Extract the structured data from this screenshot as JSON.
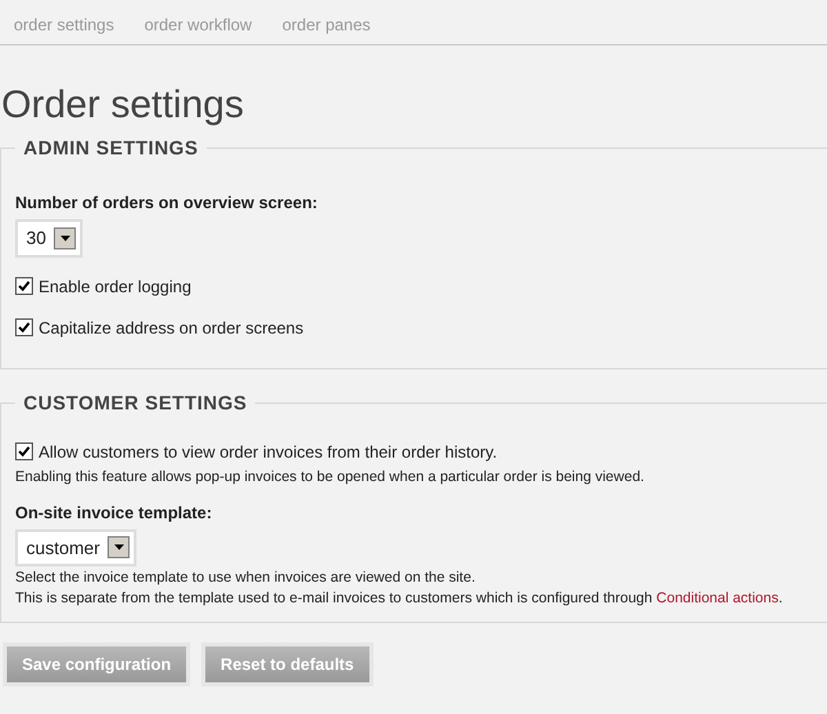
{
  "tabs": [
    {
      "label": "order settings"
    },
    {
      "label": "order workflow"
    },
    {
      "label": "order panes"
    }
  ],
  "title": "Order settings",
  "admin_settings": {
    "legend": "ADMIN SETTINGS",
    "orders_select": {
      "label": "Number of orders on overview screen:",
      "value": "30"
    },
    "checkboxes": [
      {
        "label": "Enable order logging",
        "checked": true
      },
      {
        "label": "Capitalize address on order screens",
        "checked": true
      }
    ]
  },
  "customer_settings": {
    "legend": "CUSTOMER SETTINGS",
    "invoice_checkbox": {
      "label": "Allow customers to view order invoices from their order history.",
      "checked": true,
      "description": "Enabling this feature allows pop-up invoices to be opened when a particular order is being viewed."
    },
    "template_select": {
      "label": "On-site invoice template:",
      "value": "customer",
      "description": "Select the invoice template to use when invoices are viewed on the site.",
      "note": "This is separate from the template used to e-mail invoices to customers which is configured through",
      "link": "Conditional actions",
      "after_link": "."
    }
  },
  "buttons": [
    "Save configuration",
    "Reset to defaults"
  ]
}
